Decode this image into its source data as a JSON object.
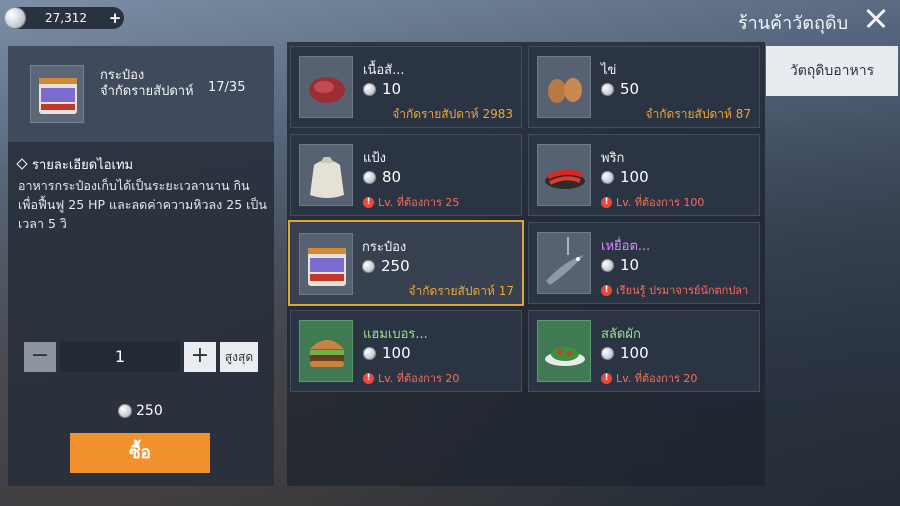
{
  "currency": {
    "amount": "27,312",
    "icon": "silver-coin-icon"
  },
  "shop": {
    "title": "ร้านค้าวัตถุดิบ"
  },
  "detail": {
    "name": "กระป๋อง",
    "limit_label": "จำกัดรายสัปดาห์",
    "limit_count": "17/35",
    "section_title": "รายละเอียดไอเทม",
    "description": "อาหารกระป๋องเก็บได้เป็นระยะเวลานาน กินเพื่อฟื้นฟู 25 HP และลดค่าความหิวลง 25 เป็นเวลา 5 วิ",
    "quantity": "1",
    "minus": "−",
    "plus": "+",
    "max_label": "สูงสุด",
    "total": "250",
    "buy_label": "ซื้อ"
  },
  "tabs": [
    {
      "label": "วัตถุดิบอาหาร",
      "active": true
    }
  ],
  "items": [
    {
      "name": "เนื้อสั...",
      "price": "10",
      "note": "จำกัดรายสัปดาห์ 2983",
      "icon": "raw-meat-icon"
    },
    {
      "name": "ไข่",
      "price": "50",
      "note": "จำกัดรายสัปดาห์ 87",
      "icon": "eggs-icon"
    },
    {
      "name": "แป้ง",
      "price": "80",
      "req": "Lv. ที่ต้องการ 25",
      "icon": "flour-sack-icon"
    },
    {
      "name": "พริก",
      "price": "100",
      "req": "Lv. ที่ต้องการ 100",
      "icon": "chili-peppers-icon"
    },
    {
      "name": "กระป๋อง",
      "price": "250",
      "note": "จำกัดรายสัปดาห์ 17",
      "icon": "canned-food-icon",
      "selected": true
    },
    {
      "name": "เหยื่อต...",
      "price": "10",
      "req": "เรียนรู้ ปรมาจารย์นักตกปลา",
      "icon": "fishing-lure-icon",
      "rarity_color": "#d98bff"
    },
    {
      "name": "แฮมเบอร...",
      "price": "100",
      "req": "Lv. ที่ต้องการ 20",
      "icon": "hamburger-icon",
      "rarity_color": "#9be08a"
    },
    {
      "name": "สลัดผัก",
      "price": "100",
      "req": "Lv. ที่ต้องการ 20",
      "icon": "salad-icon",
      "rarity_color": "#9be08a"
    }
  ],
  "colors": {
    "accent": "#f2922d",
    "selected_border": "#e0a537",
    "limit_text": "#f0a43a",
    "warning": "#ff6a5c"
  }
}
